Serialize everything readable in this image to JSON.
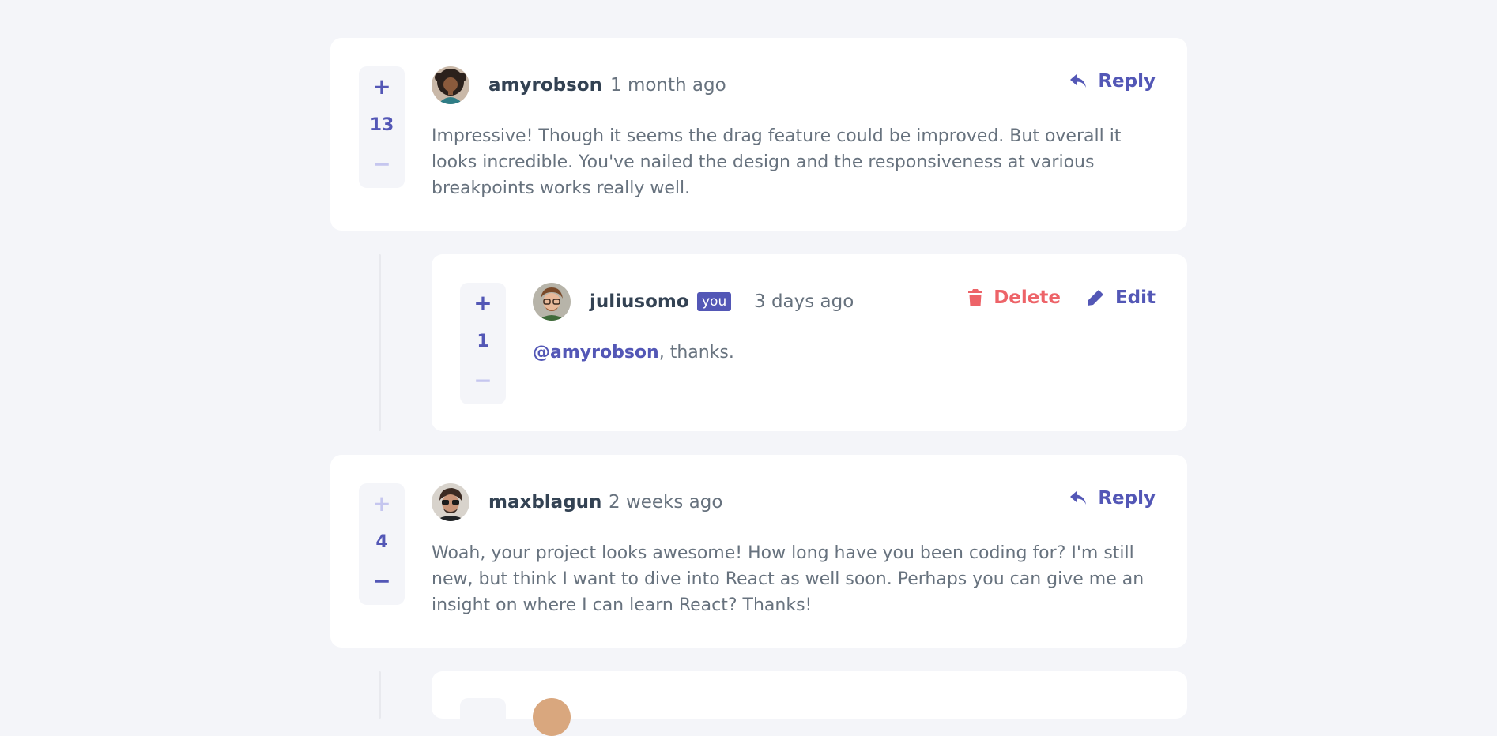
{
  "comments": [
    {
      "score": "13",
      "plus": "+",
      "minus": "−",
      "username": "amyrobson",
      "created_at": "1 month ago",
      "avatar_icon": "avatar-amyrobson",
      "reply_label": "Reply",
      "content": "Impressive! Though it seems the drag feature could be improved. But overall it looks incredible. You've nailed the design and the responsiveness at various breakpoints works really well."
    },
    {
      "score": "1",
      "plus": "+",
      "minus": "−",
      "username": "juliusomo",
      "you_badge": "you",
      "created_at": "3 days ago",
      "avatar_icon": "avatar-juliusomo",
      "delete_label": "Delete",
      "edit_label": "Edit",
      "mention": "@amyrobson",
      "content": ", thanks."
    },
    {
      "score": "4",
      "plus": "+",
      "minus": "−",
      "username": "maxblagun",
      "created_at": "2 weeks ago",
      "avatar_icon": "avatar-maxblagun",
      "reply_label": "Reply",
      "content": "Woah, your project looks awesome! How long have you been coding for? I'm still new, but think I want to dive into React as well soon. Perhaps you can give me an insight on where I can learn React? Thanks!"
    }
  ],
  "colors": {
    "background": "#f4f5f9",
    "card": "#ffffff",
    "primary": "#5357b6",
    "primary_light": "#c5c6ef",
    "danger": "#ed6368",
    "heading": "#334253",
    "body_text": "#67727e"
  }
}
